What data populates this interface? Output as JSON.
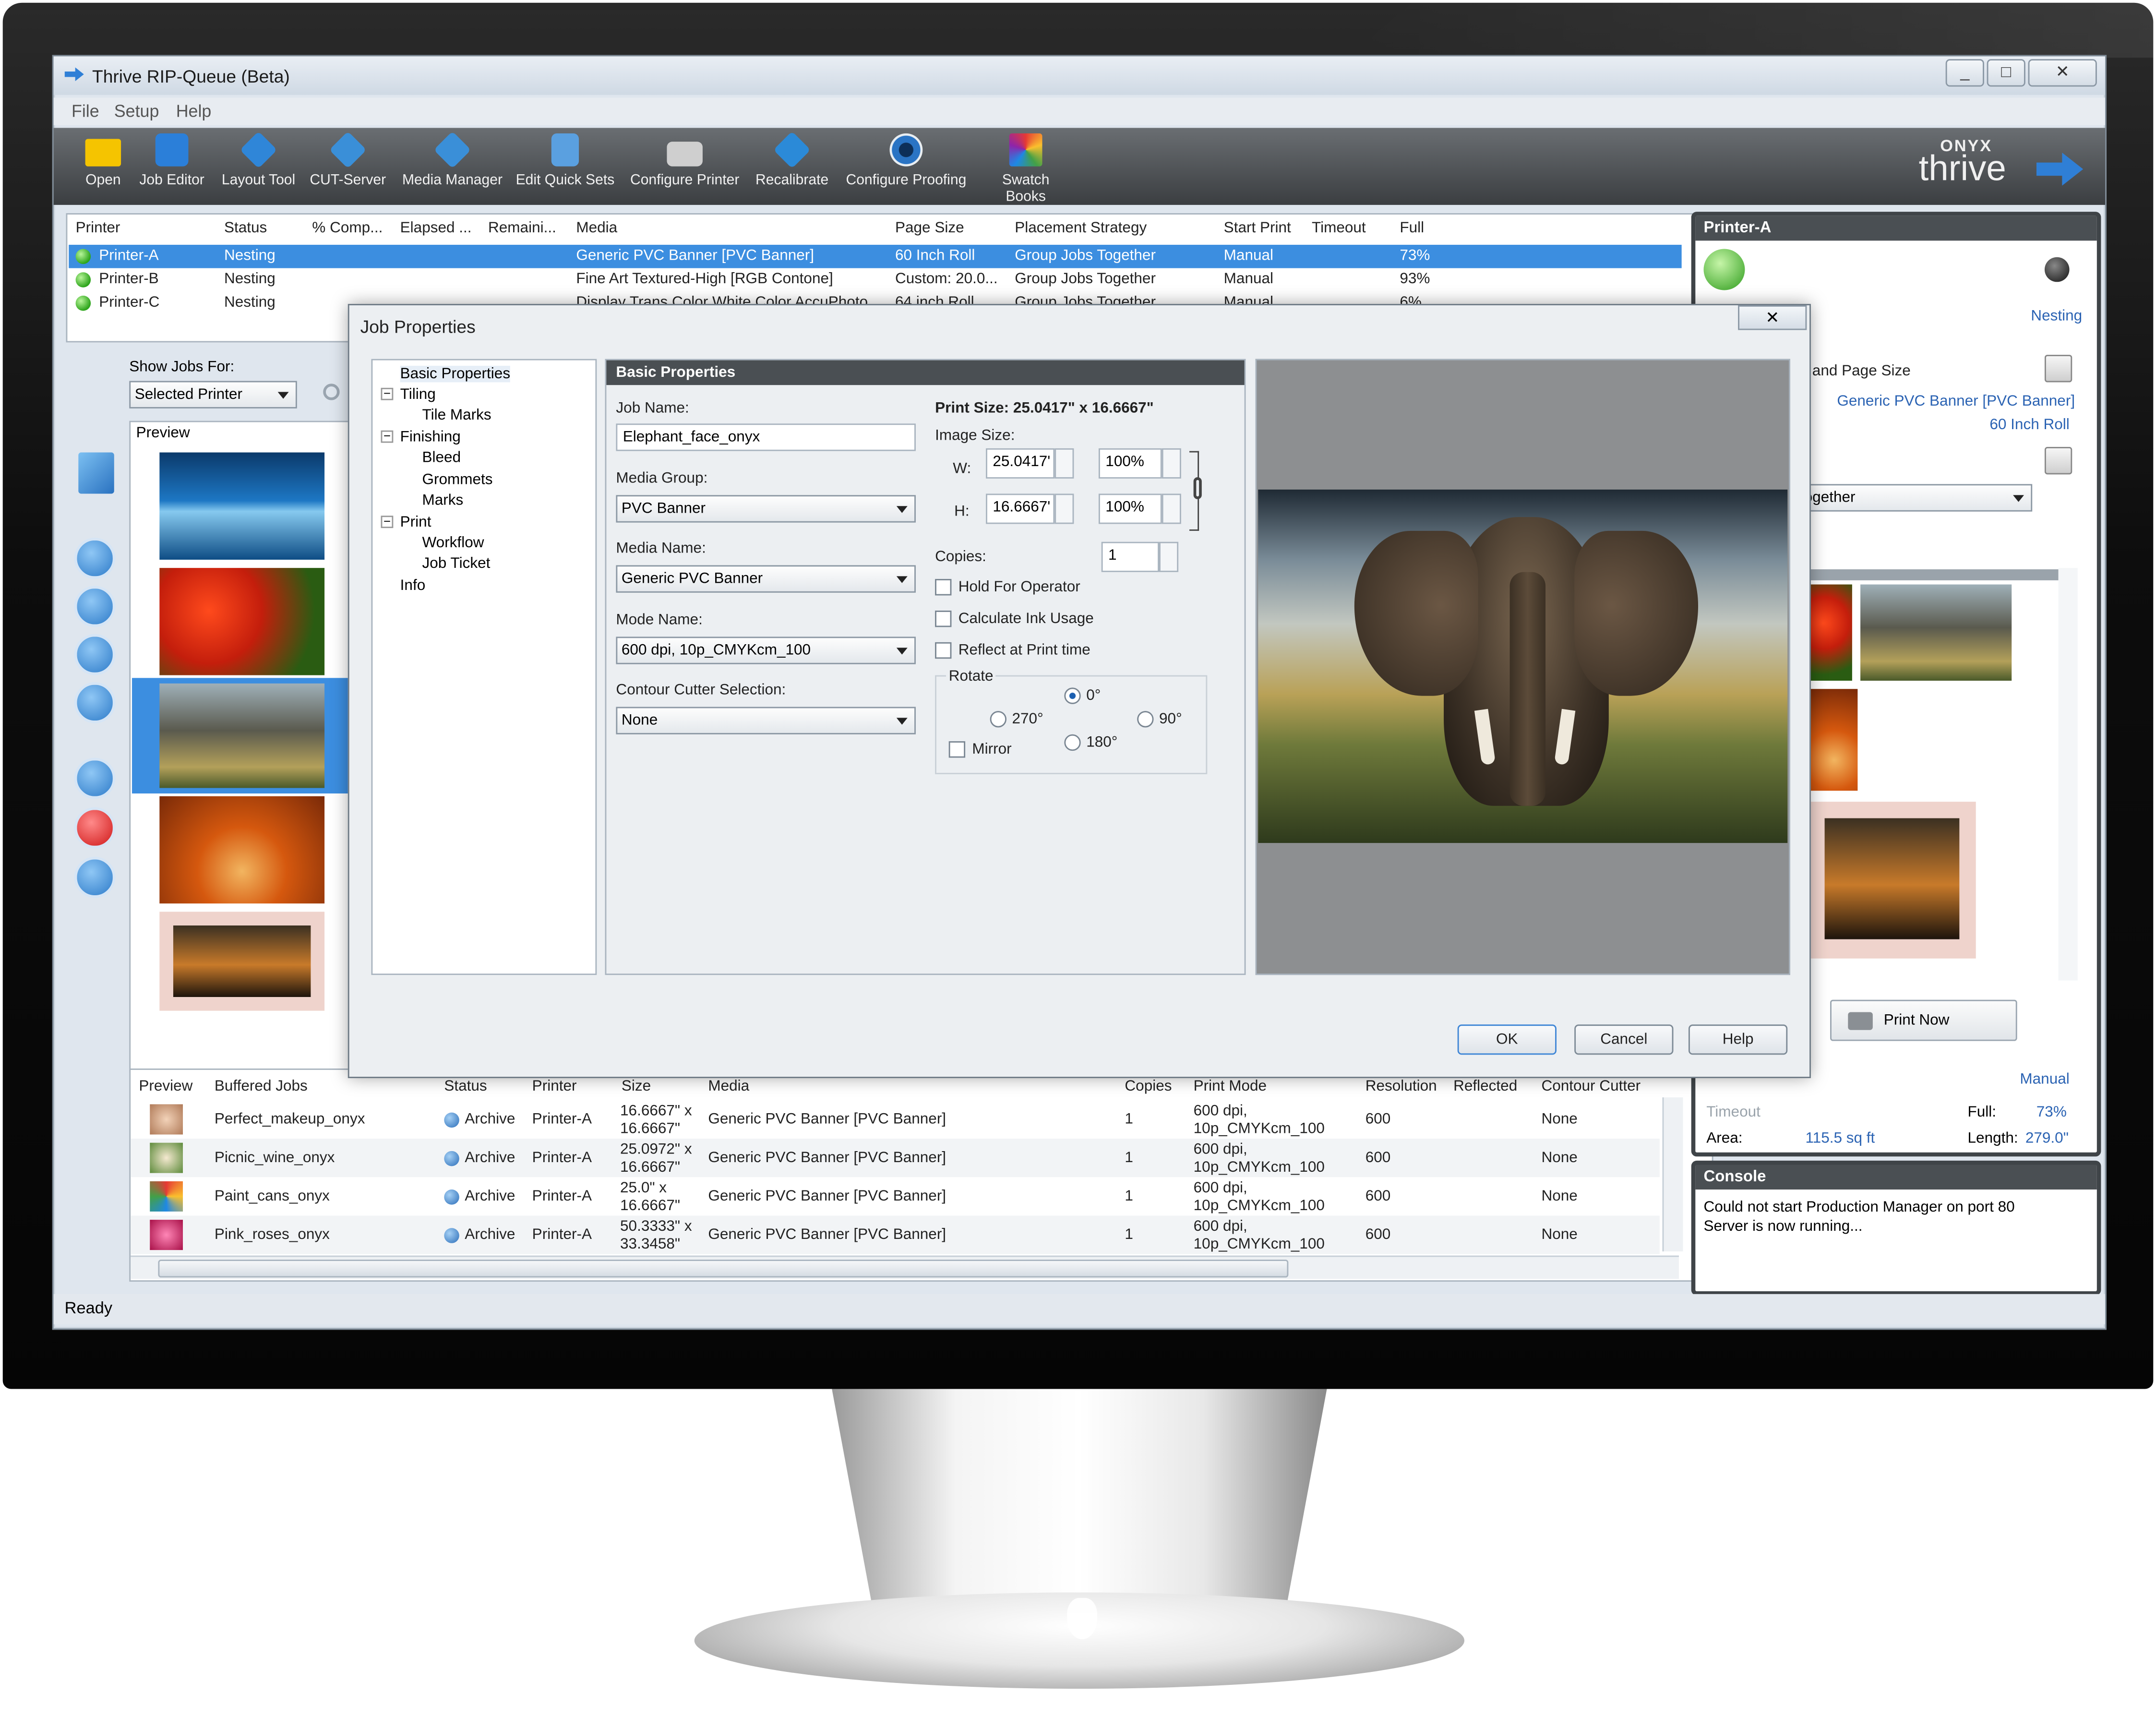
{
  "window": {
    "title": "Thrive RIP-Queue (Beta)",
    "controls": {
      "minimize": "_",
      "maximize": "□",
      "close": "✕"
    }
  },
  "menu": [
    "File",
    "Setup",
    "Help"
  ],
  "toolbar": [
    {
      "label": "Open",
      "icon": "folder-icon",
      "color": "#f5c400"
    },
    {
      "label": "Job Editor",
      "icon": "job-editor-icon",
      "color": "#2b7fd9"
    },
    {
      "label": "Layout Tool",
      "icon": "layout-tool-icon",
      "color": "#2f86d8"
    },
    {
      "label": "CUT-Server",
      "icon": "cut-server-icon",
      "color": "#3a8fd8"
    },
    {
      "label": "Media Manager",
      "icon": "media-manager-icon",
      "color": "#3a8fd8"
    },
    {
      "label": "Edit Quick Sets",
      "icon": "quick-sets-icon",
      "color": "#5aa0e0"
    },
    {
      "label": "Configure Printer",
      "icon": "printer-icon",
      "color": "#cfcfcf"
    },
    {
      "label": "Recalibrate",
      "icon": "recalibrate-icon",
      "color": "#2b8ad8"
    },
    {
      "label": "Configure Proofing",
      "icon": "eye-icon",
      "color": "#2a74c4"
    },
    {
      "label": "Swatch Books",
      "icon": "swatch-books-icon",
      "color": "#e8e8e8"
    }
  ],
  "logo": {
    "brand": "ONYX",
    "product": "thrive"
  },
  "printers": {
    "headers": [
      "Printer",
      "Status",
      "% Comp...",
      "Elapsed ...",
      "Remaini...",
      "Media",
      "Page Size",
      "Placement Strategy",
      "Start Print",
      "Timeout",
      "Full"
    ],
    "rows": [
      {
        "printer": "Printer-A",
        "status": "Nesting",
        "media": "Generic PVC Banner [PVC Banner]",
        "page_size": "60 Inch Roll",
        "placement": "Group Jobs Together",
        "start": "Manual",
        "full": "73%",
        "selected": true
      },
      {
        "printer": "Printer-B",
        "status": "Nesting",
        "media": "Fine Art Textured-High [RGB Contone]",
        "page_size": "Custom: 20.0...",
        "placement": "Group Jobs Together",
        "start": "Manual",
        "full": "93%",
        "selected": false
      },
      {
        "printer": "Printer-C",
        "status": "Nesting",
        "media": "Display Trans Color White Color AccuPhoto",
        "page_size": "64 inch Roll",
        "placement": "Group Jobs Together",
        "start": "Manual",
        "full": "6%",
        "selected": false
      }
    ]
  },
  "show_jobs": {
    "label": "Show Jobs For:",
    "value": "Selected Printer"
  },
  "preview_label": "Preview",
  "buffered": {
    "headers": [
      "Preview",
      "Buffered Jobs",
      "Status",
      "Printer",
      "Size",
      "Media",
      "Copies",
      "Print Mode",
      "Resolution",
      "Reflected",
      "Contour Cutter"
    ],
    "rows": [
      {
        "name": "Perfect_makeup_onyx",
        "status": "Archive",
        "printer": "Printer-A",
        "size1": "16.6667\" x",
        "size2": "16.6667\"",
        "media": "Generic PVC Banner [PVC Banner]",
        "copies": "1",
        "mode1": "600 dpi,",
        "mode2": "10p_CMYKcm_100",
        "res": "600",
        "cutter": "None"
      },
      {
        "name": "Picnic_wine_onyx",
        "status": "Archive",
        "printer": "Printer-A",
        "size1": "25.0972\" x",
        "size2": "16.6667\"",
        "media": "Generic PVC Banner [PVC Banner]",
        "copies": "1",
        "mode1": "600 dpi,",
        "mode2": "10p_CMYKcm_100",
        "res": "600",
        "cutter": "None"
      },
      {
        "name": "Paint_cans_onyx",
        "status": "Archive",
        "printer": "Printer-A",
        "size1": "25.0\" x",
        "size2": "16.6667\"",
        "media": "Generic PVC Banner [PVC Banner]",
        "copies": "1",
        "mode1": "600 dpi,",
        "mode2": "10p_CMYKcm_100",
        "res": "600",
        "cutter": "None"
      },
      {
        "name": "Pink_roses_onyx",
        "status": "Archive",
        "printer": "Printer-A",
        "size1": "50.3333\" x",
        "size2": "33.3458\"",
        "media": "Generic PVC Banner [PVC Banner]",
        "copies": "1",
        "mode1": "600 dpi,",
        "mode2": "10p_CMYKcm_100",
        "res": "600",
        "cutter": "None"
      }
    ]
  },
  "right_panel": {
    "title": "Printer-A",
    "status": "Nesting",
    "section": "and Page Size",
    "media": "Generic PVC Banner [PVC Banner]",
    "page_size": "60 Inch Roll",
    "placement": "ogether",
    "print_now": "Print Now",
    "start_mode": "Manual",
    "timeout_label": "Timeout",
    "full_label": "Full:",
    "full_value": "73%",
    "area_label": "Area:",
    "area_value": "115.5 sq ft",
    "length_label": "Length:",
    "length_value": "279.0\""
  },
  "console": {
    "title": "Console",
    "lines": [
      "Could not start Production Manager on port 80",
      "Server is now running..."
    ]
  },
  "status_bar": "Ready",
  "dialog": {
    "title": "Job Properties",
    "tree": [
      "Basic Properties",
      "Tiling",
      "Tile Marks",
      "Finishing",
      "Bleed",
      "Grommets",
      "Marks",
      "Print",
      "Workflow",
      "Job Ticket",
      "Info"
    ],
    "section_title": "Basic Properties",
    "job_name_label": "Job Name:",
    "job_name": "Elephant_face_onyx",
    "media_group_label": "Media Group:",
    "media_group": "PVC Banner",
    "media_name_label": "Media Name:",
    "media_name": "Generic PVC Banner",
    "mode_name_label": "Mode Name:",
    "mode_name": "600 dpi, 10p_CMYKcm_100",
    "contour_label": "Contour Cutter Selection:",
    "contour": "None",
    "print_size": "Print Size: 25.0417\" x 16.6667\"",
    "image_size_label": "Image Size:",
    "w_label": "W:",
    "w_value": "25.0417'",
    "w_pct": "100%",
    "h_label": "H:",
    "h_value": "16.6667'",
    "h_pct": "100%",
    "copies_label": "Copies:",
    "copies": "1",
    "hold": "Hold For Operator",
    "calc_ink": "Calculate Ink Usage",
    "reflect": "Reflect at Print time",
    "rotate_label": "Rotate",
    "r0": "0°",
    "r270": "270°",
    "r90": "90°",
    "r180": "180°",
    "mirror": "Mirror",
    "ok": "OK",
    "cancel": "Cancel",
    "help": "Help"
  }
}
